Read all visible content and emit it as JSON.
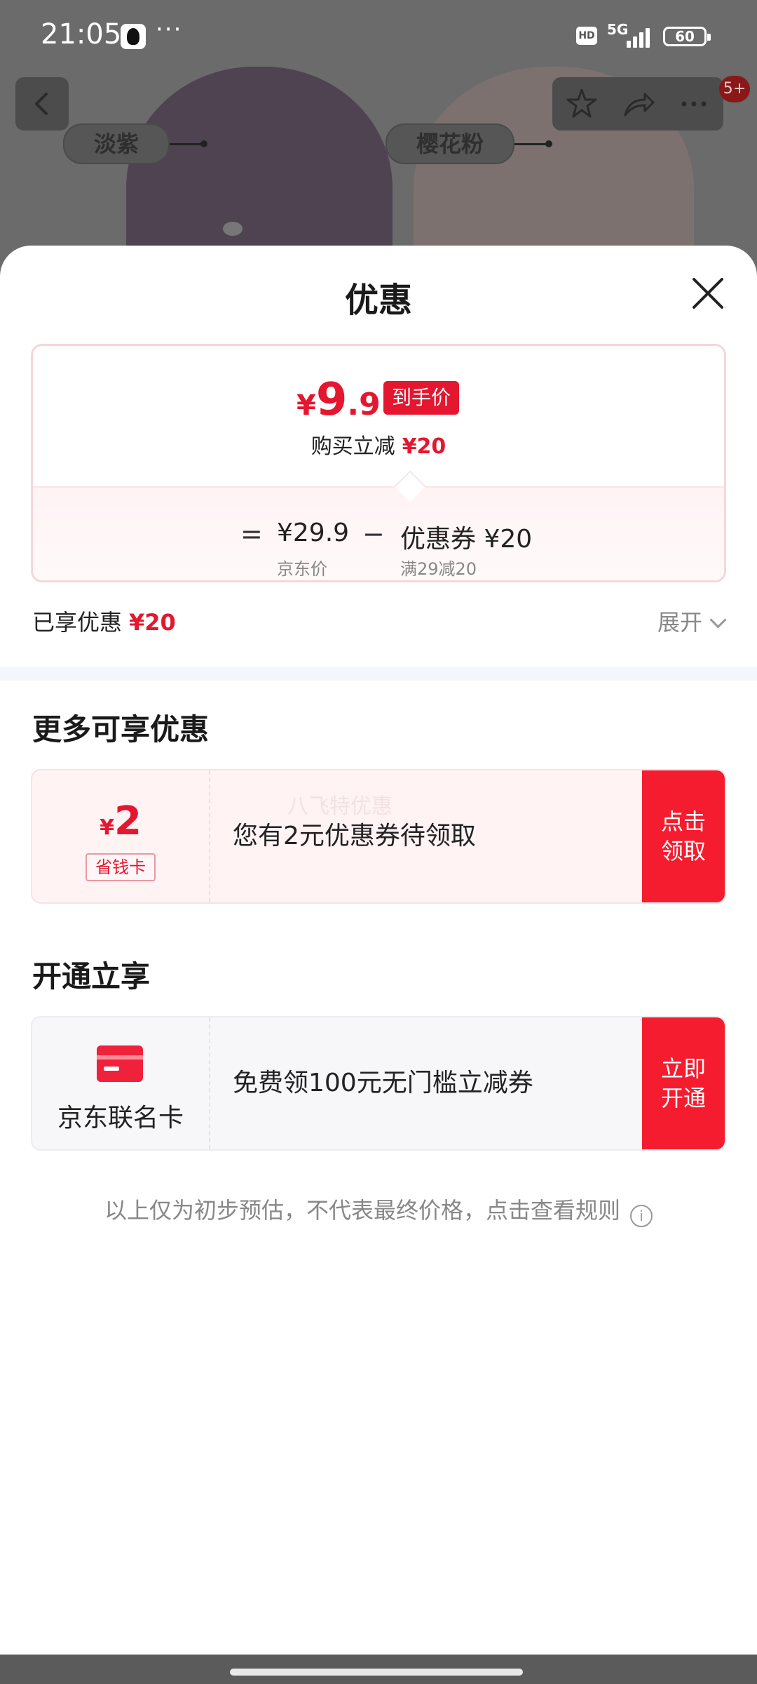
{
  "status_bar": {
    "time": "21:05",
    "more": "···",
    "hd": "HD",
    "network": "5G",
    "battery": "60"
  },
  "background": {
    "color_labels": [
      "淡紫",
      "樱花粉"
    ],
    "cart_badge": "5+"
  },
  "sheet": {
    "title": "优惠",
    "price_card": {
      "currency": "¥",
      "price_int": "9",
      "price_dec": ".9",
      "final_label": "到手价",
      "reduce_text": "购买立减",
      "reduce_amount": "¥20",
      "formula": {
        "equals": "=",
        "base_price": "¥29.9",
        "base_label": "京东价",
        "minus": "−",
        "coupon_value": "优惠券 ¥20",
        "coupon_label": "满29减20"
      }
    },
    "enjoyed": {
      "label": "已享优惠",
      "amount": "¥20"
    },
    "expand_label": "展开",
    "more_offers": {
      "title": "更多可享优惠",
      "coupon": {
        "currency": "¥",
        "amount": "2",
        "tag": "省钱卡",
        "watermark": "八飞特优惠",
        "text": "您有2元优惠券待领取",
        "button": [
          "点击",
          "领取"
        ]
      }
    },
    "open_section": {
      "title": "开通立享",
      "card": {
        "name": "京东联名卡",
        "text": "免费领100元无门槛立减券",
        "button": [
          "立即",
          "开通"
        ]
      }
    },
    "disclaimer": "以上仅为初步预估，不代表最终价格，点击查看规则",
    "info_icon": "i"
  },
  "colors": {
    "accent_red": "#e5162f",
    "button_red": "#f51c2f"
  },
  "icons": [
    "back-arrow-icon",
    "star-icon",
    "share-icon",
    "more-icon",
    "close-icon",
    "chevron-down-icon",
    "info-icon",
    "credit-card-icon"
  ]
}
